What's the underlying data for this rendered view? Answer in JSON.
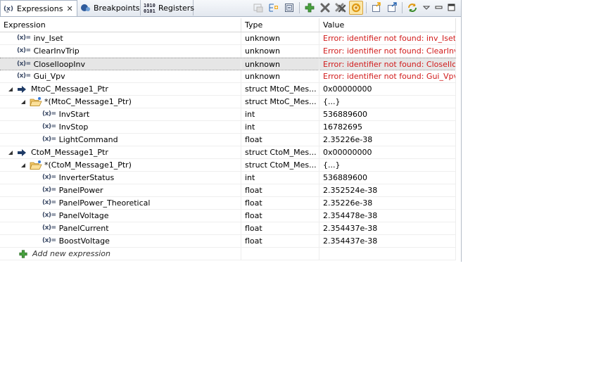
{
  "tabs": [
    {
      "label": "Expressions",
      "icon": "expressions-icon",
      "active": true,
      "close": "✕"
    },
    {
      "label": "Breakpoints",
      "icon": "breakpoints-icon",
      "active": false
    },
    {
      "label": "Registers",
      "icon": "registers-icon",
      "active": false
    }
  ],
  "columns": {
    "expression": "Expression",
    "type": "Type",
    "value": "Value"
  },
  "variable_badge": "(x)=",
  "rows": [
    {
      "indent": 0,
      "twisty": "",
      "icon": "variable",
      "name": "inv_Iset",
      "type": "unknown",
      "value": "Error: identifier not found: inv_Iset",
      "error": true
    },
    {
      "indent": 0,
      "twisty": "",
      "icon": "variable",
      "name": "ClearInvTrip",
      "type": "unknown",
      "value": "Error: identifier not found: ClearInvTrip",
      "error": true
    },
    {
      "indent": 0,
      "twisty": "",
      "icon": "variable",
      "name": "CloseIloopInv",
      "type": "unknown",
      "value": "Error: identifier not found: CloseIloopInv",
      "error": true,
      "selected": true
    },
    {
      "indent": 0,
      "twisty": "",
      "icon": "variable",
      "name": "Gui_Vpv",
      "type": "unknown",
      "value": "Error: identifier not found: Gui_Vpv",
      "error": true
    },
    {
      "indent": 0,
      "twisty": "expanded",
      "icon": "pointer",
      "name": "MtoC_Message1_Ptr",
      "type": "struct MtoC_Mes...",
      "value": "0x00000000"
    },
    {
      "indent": 1,
      "twisty": "expanded",
      "icon": "struct",
      "name": "*(MtoC_Message1_Ptr)",
      "type": "struct MtoC_Mes...",
      "value": "{...}"
    },
    {
      "indent": 2,
      "twisty": "",
      "icon": "variable",
      "name": "InvStart",
      "type": "int",
      "value": "536889600"
    },
    {
      "indent": 2,
      "twisty": "",
      "icon": "variable",
      "name": "InvStop",
      "type": "int",
      "value": "16782695"
    },
    {
      "indent": 2,
      "twisty": "",
      "icon": "variable",
      "name": "LightCommand",
      "type": "float",
      "value": "2.35226e-38"
    },
    {
      "indent": 0,
      "twisty": "expanded",
      "icon": "pointer",
      "name": "CtoM_Message1_Ptr",
      "type": "struct CtoM_Mes...",
      "value": "0x00000000"
    },
    {
      "indent": 1,
      "twisty": "expanded",
      "icon": "struct",
      "name": "*(CtoM_Message1_Ptr)",
      "type": "struct CtoM_Mes...",
      "value": "{...}"
    },
    {
      "indent": 2,
      "twisty": "",
      "icon": "variable",
      "name": "InverterStatus",
      "type": "int",
      "value": "536889600"
    },
    {
      "indent": 2,
      "twisty": "",
      "icon": "variable",
      "name": "PanelPower",
      "type": "float",
      "value": "2.352524e-38"
    },
    {
      "indent": 2,
      "twisty": "",
      "icon": "variable",
      "name": "PanelPower_Theoretical",
      "type": "float",
      "value": "2.35226e-38"
    },
    {
      "indent": 2,
      "twisty": "",
      "icon": "variable",
      "name": "PanelVoltage",
      "type": "float",
      "value": "2.354478e-38"
    },
    {
      "indent": 2,
      "twisty": "",
      "icon": "variable",
      "name": "PanelCurrent",
      "type": "float",
      "value": "2.354437e-38"
    },
    {
      "indent": 2,
      "twisty": "",
      "icon": "variable",
      "name": "BoostVoltage",
      "type": "float",
      "value": "2.354437e-38"
    }
  ],
  "add_row": {
    "label": "Add new expression",
    "icon": "add-plus-icon"
  },
  "toolbar": [
    {
      "name": "show-type-names-icon",
      "disabled": true
    },
    {
      "name": "expand-all-icon"
    },
    {
      "name": "collapse-all-icon"
    },
    {
      "sep": true
    },
    {
      "name": "add-expression-icon"
    },
    {
      "name": "remove-expression-icon"
    },
    {
      "name": "remove-all-expressions-icon"
    },
    {
      "name": "continuous-refresh-icon",
      "pressed": true
    },
    {
      "sep": true
    },
    {
      "name": "import-icon"
    },
    {
      "name": "export-icon"
    },
    {
      "sep": true
    },
    {
      "name": "refresh-icon"
    },
    {
      "name": "view-menu-icon"
    },
    {
      "name": "minimize-icon"
    },
    {
      "name": "maximize-icon"
    }
  ],
  "colors": {
    "error": "#d11a1a",
    "selection": "#e6e6e6",
    "pressed": "#fbe7a9",
    "pointer_arrow": "#1f3b66"
  }
}
